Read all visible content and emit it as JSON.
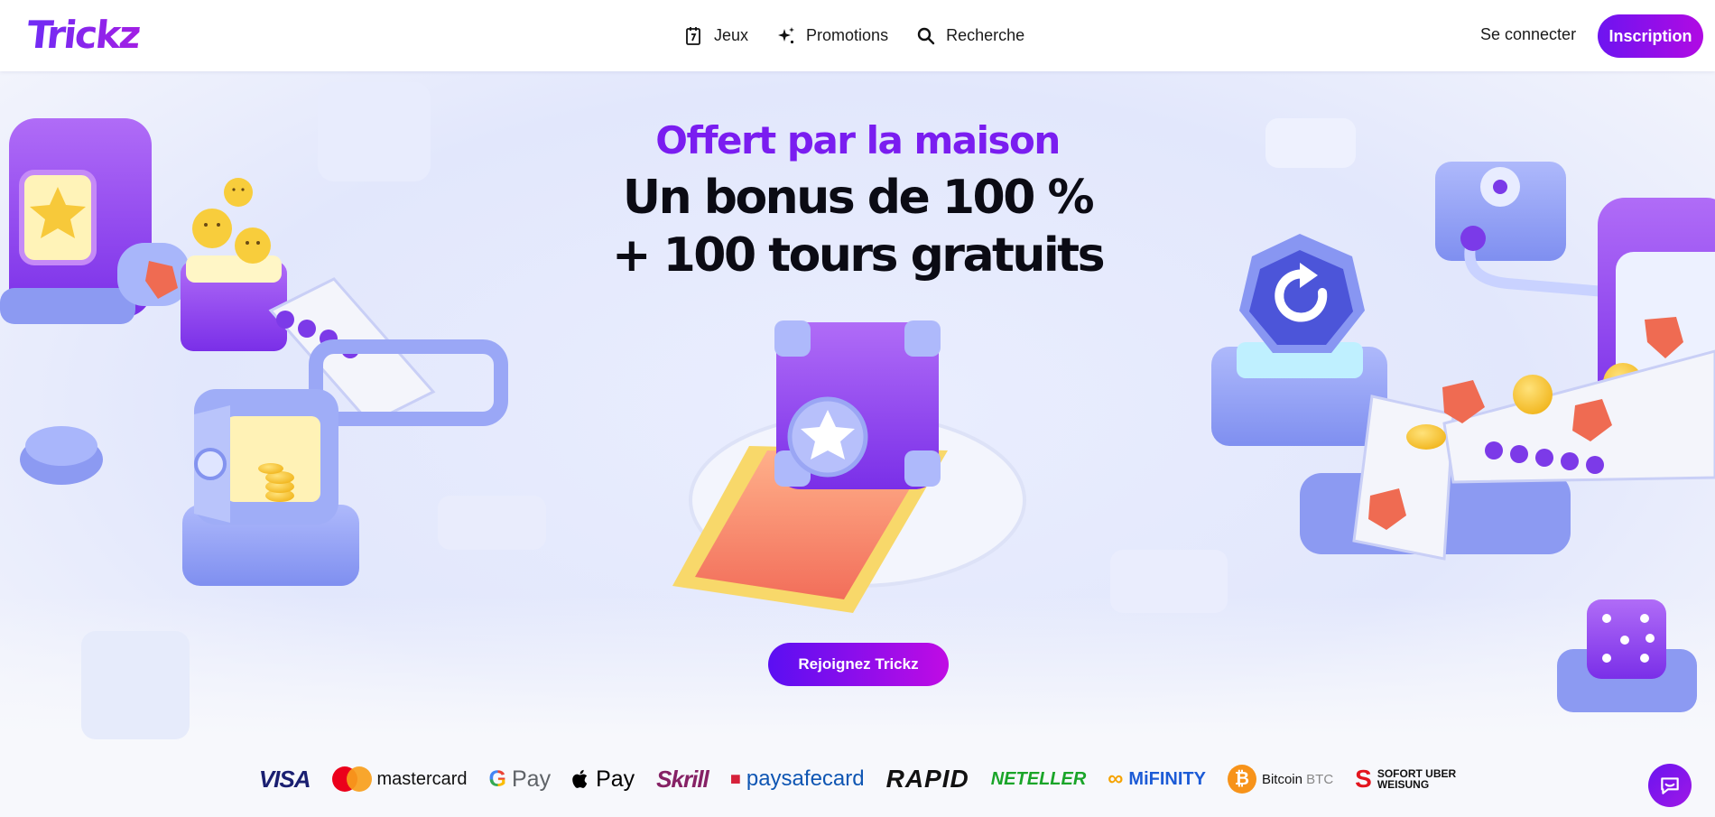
{
  "header": {
    "logo": "Trickz",
    "nav": [
      {
        "label": "Jeux",
        "icon": "calendar-seven-icon"
      },
      {
        "label": "Promotions",
        "icon": "sparkles-icon"
      },
      {
        "label": "Recherche",
        "icon": "search-icon"
      }
    ],
    "login_label": "Se connecter",
    "signup_label": "Inscription"
  },
  "hero": {
    "tagline": "Offert par la maison",
    "headline_line1": "Un bonus de 100 %",
    "headline_line2": "+ 100 tours gratuits",
    "cta_label": "Rejoignez Trickz"
  },
  "payments": {
    "visa": "VISA",
    "mastercard": "mastercard",
    "gpay": "Pay",
    "applepay": "Pay",
    "skrill": "Skrill",
    "paysafecard": "paysafecard",
    "rapid": "RAPID",
    "neteller": "NETELLER",
    "mifinity": "MiFINITY",
    "bitcoin": "Bitcoin",
    "bitcoin_ticker": "BTC",
    "sofort_line1": "SOFORT UBER",
    "sofort_line2": "WEISUNG"
  },
  "chat": {
    "icon": "chat-bubble-icon"
  },
  "colors": {
    "brand_purple": "#7a1df0",
    "cta_gradient_start": "#5a0ff2",
    "cta_gradient_end": "#c00ce4",
    "hero_bg": "#e2e7fc"
  }
}
